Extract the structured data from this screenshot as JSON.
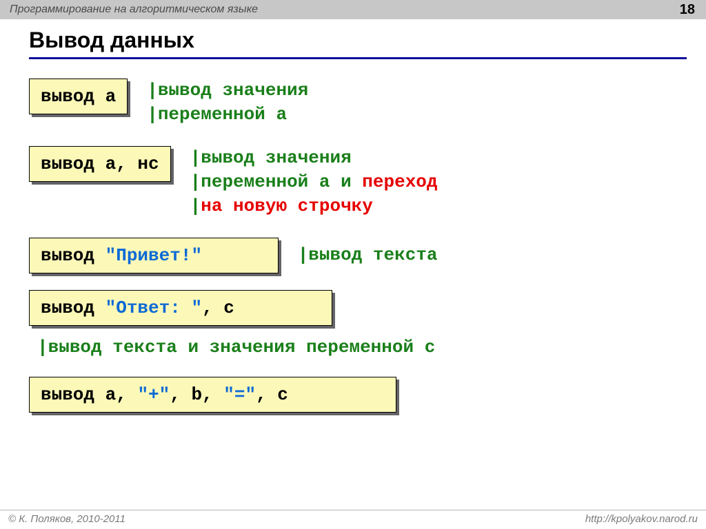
{
  "header": {
    "course": "Программирование на алгоритмическом языке",
    "page": "18"
  },
  "title": "Вывод данных",
  "rows": [
    {
      "code": [
        {
          "text": "вывод a",
          "cls": "c-black"
        }
      ],
      "desc": [
        {
          "pipe": "|",
          "text": "вывод значения",
          "cls": "c-green"
        },
        {
          "pipe": "|",
          "text": "переменной a",
          "cls": "c-green"
        }
      ]
    },
    {
      "code": [
        {
          "text": "вывод a, нс",
          "cls": "c-black"
        }
      ],
      "desc": [
        {
          "pipe": "|",
          "parts": [
            {
              "text": "вывод значения",
              "cls": "c-green"
            }
          ]
        },
        {
          "pipe": "|",
          "parts": [
            {
              "text": "переменной a и ",
              "cls": "c-green"
            },
            {
              "text": "переход",
              "cls": "c-red"
            }
          ]
        },
        {
          "pipe": "|",
          "parts": [
            {
              "text": "на новую строчку",
              "cls": "c-red"
            }
          ]
        }
      ]
    },
    {
      "code": [
        {
          "text": "вывод ",
          "cls": "c-black"
        },
        {
          "text": "\"Привет!\"",
          "cls": "c-blue"
        },
        {
          "text": "      ",
          "cls": "c-black"
        }
      ],
      "desc_inline": [
        {
          "pipe": "|",
          "text": "вывод текста",
          "cls": "c-green"
        }
      ]
    },
    {
      "code": [
        {
          "text": "вывод ",
          "cls": "c-black"
        },
        {
          "text": "\"Ответ: \"",
          "cls": "c-blue"
        },
        {
          "text": ", c        ",
          "cls": "c-black"
        }
      ],
      "desc_below": {
        "pipe": "|",
        "text": "вывод текста и значения переменной c",
        "cls": "c-green"
      }
    },
    {
      "code": [
        {
          "text": "вывод a, ",
          "cls": "c-black"
        },
        {
          "text": "\"+\"",
          "cls": "c-blue"
        },
        {
          "text": ", b, ",
          "cls": "c-black"
        },
        {
          "text": "\"=\"",
          "cls": "c-blue"
        },
        {
          "text": ", c         ",
          "cls": "c-black"
        }
      ]
    }
  ],
  "footer": {
    "copyright": "© К. Поляков, 2010-2011",
    "url": "http://kpolyakov.narod.ru"
  }
}
